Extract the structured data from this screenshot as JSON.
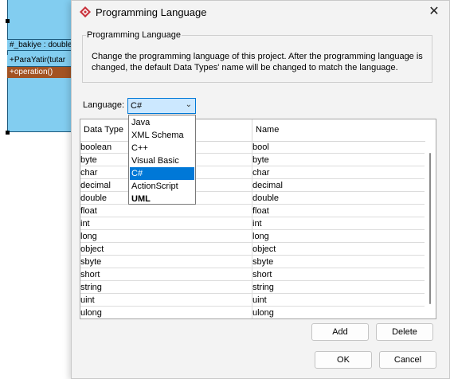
{
  "background": {
    "uml_attribute": "#_bakiye : double",
    "uml_operation_1": "+ParaYatir(tutar",
    "uml_operation_2": "+operation()"
  },
  "dialog": {
    "title": "Programming Language",
    "close_icon": "close-icon",
    "group_legend": "Programming Language",
    "description": "Change the programming language of this project. After the programming language is changed, the default Data Types' name will be changed to match the language.",
    "language_label": "Language:",
    "language_value": "C#",
    "language_options": [
      "Java",
      "XML Schema",
      "C++",
      "Visual Basic",
      "C#",
      "ActionScript",
      "UML"
    ],
    "selected_option": "C#",
    "table": {
      "columns": [
        "Data Type",
        "Name"
      ],
      "rows": [
        [
          "boolean",
          "bool"
        ],
        [
          "byte",
          "byte"
        ],
        [
          "char",
          "char"
        ],
        [
          "decimal",
          "decimal"
        ],
        [
          "double",
          "double"
        ],
        [
          "float",
          "float"
        ],
        [
          "int",
          "int"
        ],
        [
          "long",
          "long"
        ],
        [
          "object",
          "object"
        ],
        [
          "sbyte",
          "sbyte"
        ],
        [
          "short",
          "short"
        ],
        [
          "string",
          "string"
        ],
        [
          "uint",
          "uint"
        ],
        [
          "ulong",
          "ulong"
        ]
      ]
    },
    "buttons": {
      "add": "Add",
      "delete": "Delete",
      "ok": "OK",
      "cancel": "Cancel"
    }
  },
  "colors": {
    "accent": "#0078d7",
    "selection_bg": "#cce8ff",
    "uml_fill": "#82cdf0",
    "uml_highlight": "#a35323",
    "app_icon": "#c8323c"
  }
}
